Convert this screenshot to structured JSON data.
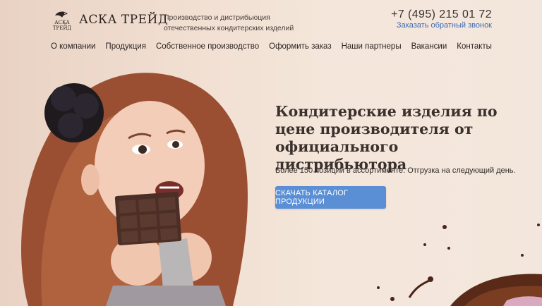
{
  "brand": {
    "name": "АСКА ТРЕЙД",
    "logo_icon": "fish-logo-icon",
    "logo_lines": [
      "АСКА",
      "ТРЕЙД"
    ],
    "tagline_line1": "Производство и дистрибьюция",
    "tagline_line2": "отечественных кондитерских изделий"
  },
  "contact": {
    "phone": "+7 (495) 215 01 72",
    "callback_label": "Заказать обратный звонок"
  },
  "nav": {
    "items": [
      {
        "label": "О компании"
      },
      {
        "label": "Продукция"
      },
      {
        "label": "Собственное производство"
      },
      {
        "label": "Оформить заказ"
      },
      {
        "label": "Наши партнеры"
      },
      {
        "label": "Вакансии"
      },
      {
        "label": "Контакты"
      }
    ]
  },
  "hero": {
    "title": "Кондитерские изделия по цене производителя от официального дистрибьютора",
    "subtitle": "Более 150 позиций в ассортименте. Отгрузка на следующий день.",
    "cta_label": "СКАЧАТЬ КАТАЛОГ ПРОДУКЦИИ"
  },
  "colors": {
    "accent": "#5a8fd6",
    "link": "#3d6bb4",
    "text": "#3a302c",
    "background": "#f3e7dd"
  }
}
